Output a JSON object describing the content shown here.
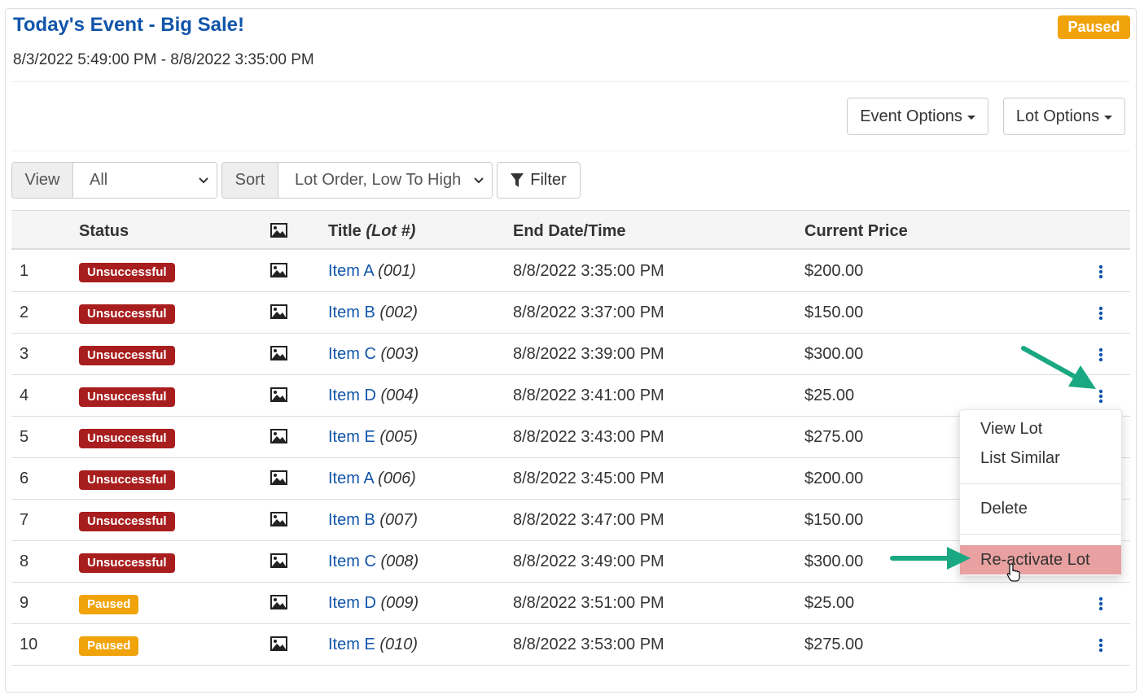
{
  "event": {
    "title": "Today's Event - Big Sale!",
    "dates": "8/3/2022 5:49:00 PM - 8/8/2022 3:35:00 PM",
    "status": "Paused"
  },
  "toolbar": {
    "event_options": "Event Options",
    "lot_options": "Lot Options"
  },
  "filters": {
    "view_label": "View",
    "view_value": "All",
    "sort_label": "Sort",
    "sort_value": "Lot Order, Low To High",
    "filter_label": "Filter"
  },
  "table": {
    "headers": {
      "status": "Status",
      "title": "Title",
      "lot": "(Lot #)",
      "end": "End Date/Time",
      "price": "Current Price"
    },
    "rows": [
      {
        "num": "1",
        "status": "Unsuccessful",
        "item": "Item A",
        "lot": "(001)",
        "end": "8/8/2022 3:35:00 PM",
        "price": "$200.00"
      },
      {
        "num": "2",
        "status": "Unsuccessful",
        "item": "Item B",
        "lot": "(002)",
        "end": "8/8/2022 3:37:00 PM",
        "price": "$150.00"
      },
      {
        "num": "3",
        "status": "Unsuccessful",
        "item": "Item C",
        "lot": "(003)",
        "end": "8/8/2022 3:39:00 PM",
        "price": "$300.00"
      },
      {
        "num": "4",
        "status": "Unsuccessful",
        "item": "Item D",
        "lot": "(004)",
        "end": "8/8/2022 3:41:00 PM",
        "price": "$25.00"
      },
      {
        "num": "5",
        "status": "Unsuccessful",
        "item": "Item E",
        "lot": "(005)",
        "end": "8/8/2022 3:43:00 PM",
        "price": "$275.00"
      },
      {
        "num": "6",
        "status": "Unsuccessful",
        "item": "Item A",
        "lot": "(006)",
        "end": "8/8/2022 3:45:00 PM",
        "price": "$200.00"
      },
      {
        "num": "7",
        "status": "Unsuccessful",
        "item": "Item B",
        "lot": "(007)",
        "end": "8/8/2022 3:47:00 PM",
        "price": "$150.00"
      },
      {
        "num": "8",
        "status": "Unsuccessful",
        "item": "Item C",
        "lot": "(008)",
        "end": "8/8/2022 3:49:00 PM",
        "price": "$300.00"
      },
      {
        "num": "9",
        "status": "Paused",
        "item": "Item D",
        "lot": "(009)",
        "end": "8/8/2022 3:51:00 PM",
        "price": "$25.00"
      },
      {
        "num": "10",
        "status": "Paused",
        "item": "Item E",
        "lot": "(010)",
        "end": "8/8/2022 3:53:00 PM",
        "price": "$275.00"
      }
    ]
  },
  "menu": {
    "view_lot": "View Lot",
    "list_similar": "List Similar",
    "delete": "Delete",
    "reactivate": "Re-activate Lot"
  },
  "colors": {
    "link": "#1155aa",
    "unsuccessful": "#a81d1d",
    "paused": "#f0a30a",
    "highlight": "#e8a0a0",
    "arrow": "#1aa882"
  }
}
